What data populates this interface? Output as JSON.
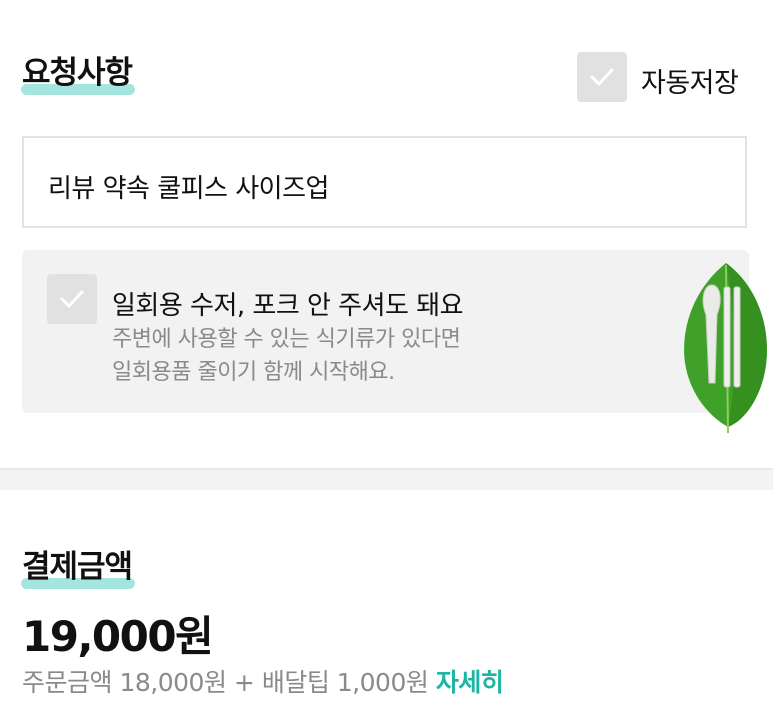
{
  "request_section": {
    "title": "요청사항",
    "auto_save_label": "자동저장",
    "request_text": "리뷰 약속 쿨피스 사이즈업"
  },
  "eco_option": {
    "title": "일회용 수저, 포크 안 주셔도 돼요",
    "desc_line1": "주변에 사용할 수 있는 식기류가 있다면",
    "desc_line2": "일회용품 줄이기 함께 시작해요."
  },
  "payment": {
    "title": "결제금액",
    "total": "19,000원",
    "order_label": "주문금액",
    "order_amount": "18,000원",
    "plus": "+",
    "delivery_label": "배달팁",
    "delivery_amount": "1,000원",
    "detail_link": "자세히"
  },
  "colors": {
    "highlight": "#a4e6df",
    "accent": "#1fb5a5",
    "checkbox_bg": "#e1e1e1",
    "card_bg": "#f2f2f2",
    "leaf": "#3fa12a"
  },
  "icons": {
    "checkbox": "check-icon",
    "illustration": "leaf-utensils-illustration"
  }
}
